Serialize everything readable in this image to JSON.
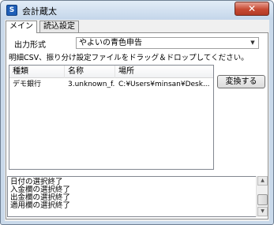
{
  "window": {
    "title": "会計蔵太",
    "app_icon": "S",
    "close_symbol": "✕"
  },
  "tabs": [
    {
      "label": "メイン",
      "active": true
    },
    {
      "label": "読込設定",
      "active": false
    }
  ],
  "main": {
    "output_format_label": "出力形式",
    "output_format_value": "やよいの青色申告",
    "instruction": "明細CSV、振り分け設定ファイルをドラッグ＆ドロップしてください。",
    "convert_button": "変換する",
    "table": {
      "columns": [
        "種類",
        "名称",
        "場所"
      ],
      "rows": [
        [
          "デモ銀行",
          "3.unknown_f...",
          "C:¥Users¥minsan¥Desk..."
        ]
      ]
    },
    "log": [
      "日付の選択終了",
      "入金欄の選択終了",
      "出金欄の選択終了",
      "適用欄の選択終了"
    ]
  },
  "colors": {
    "title_bar": "#c4d6ea",
    "close_button": "#c74a33"
  }
}
